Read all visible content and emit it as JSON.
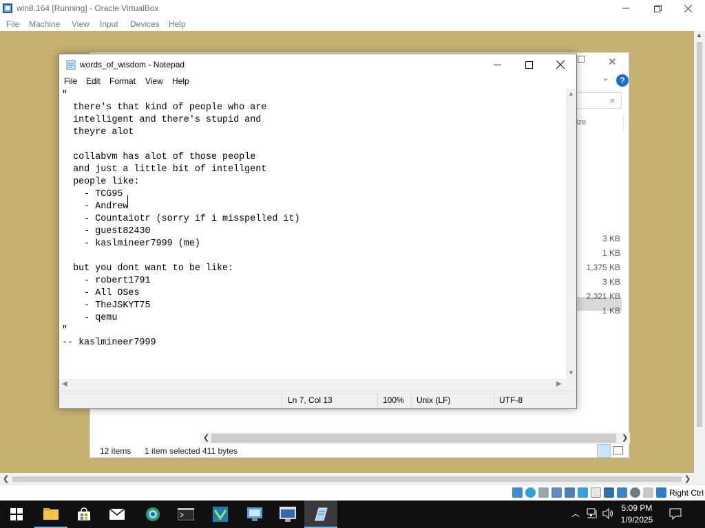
{
  "vbox": {
    "title": "win8.164 [Running] - Oracle VirtualBox",
    "menu": [
      "File",
      "Machine",
      "View",
      "Input",
      "Devices",
      "Help"
    ],
    "host_key": "Right Ctrl"
  },
  "explorer": {
    "size_header": "ize",
    "file_sizes": [
      "3 KB",
      "1 KB",
      "1,375 KB",
      "3 KB",
      "2,321 KB",
      "1 KB"
    ],
    "status": {
      "item_count": "12 items",
      "selected": "1 item selected",
      "selected_size": "411 bytes"
    },
    "help_label": "?"
  },
  "notepad": {
    "title": "words_of_wisdom - Notepad",
    "menu": [
      "File",
      "Edit",
      "Format",
      "View",
      "Help"
    ],
    "content": "\"\n  there's that kind of people who are\n  intelligent and there's stupid and\n  theyre alot\n\n  collabvm has alot of those people\n  and just a little bit of intellgent\n  people like:\n    - TCG95\n    - Andrew\n    - Countaiotr (sorry if i misspelled it)\n    - guest82430\n    - kaslmineer7999 (me)\n\n  but you dont want to be like:\n    - robert1791\n    - All OSes\n    - TheJSKYT75\n    - qemu\n\"\n-- kaslmineer7999",
    "status": {
      "position": "Ln 7, Col 13",
      "zoom": "100%",
      "line_endings": "Unix (LF)",
      "encoding": "UTF-8"
    }
  },
  "taskbar": {
    "time": "5:09 PM",
    "date": "1/9/2025",
    "items": [
      "start-button",
      "file-explorer",
      "store",
      "mail",
      "browser",
      "command-prompt",
      "visual-studio",
      "control-panel",
      "computer-info",
      "notepad"
    ]
  },
  "colors": {
    "guest_desktop": "#c6b170",
    "taskbar": "#101010",
    "accent": "#1a6fd0"
  }
}
